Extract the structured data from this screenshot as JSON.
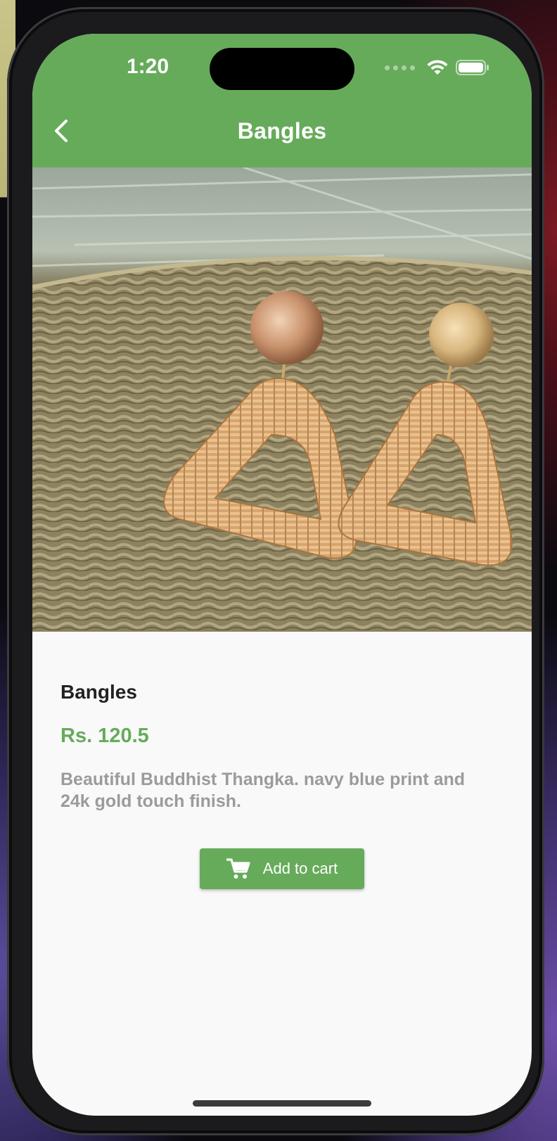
{
  "status_bar": {
    "time": "1:20"
  },
  "header": {
    "title": "Bangles"
  },
  "product": {
    "name": "Bangles",
    "price": "Rs. 120.5",
    "description": "Beautiful Buddhist Thangka. navy blue print and 24k gold touch finish.",
    "image_alt": "Woven rattan triangle earrings with gold discs on wicker basket"
  },
  "actions": {
    "add_to_cart_label": "Add to cart"
  },
  "colors": {
    "primary": "#66ab5a",
    "title_text": "#222222",
    "description_text": "#9b9b9b",
    "background": "#f9f9f9"
  },
  "icons": {
    "back": "chevron-left-icon",
    "cart": "shopping-cart-icon",
    "wifi": "wifi-icon",
    "battery": "battery-icon",
    "signal": "signal-dots-icon"
  }
}
